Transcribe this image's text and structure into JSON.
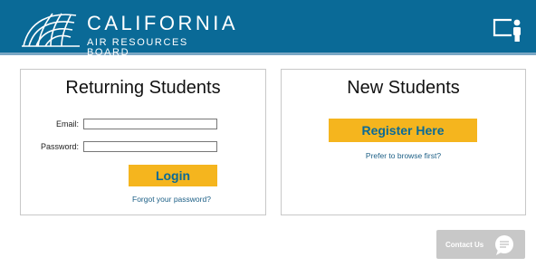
{
  "header": {
    "org_name": "CALIFORNIA",
    "org_subname": "AIR RESOURCES BOARD",
    "logo_icon": "arc-logo-icon",
    "user_icon": "user-board-icon",
    "background_color": "#0a6a97"
  },
  "returning": {
    "title": "Returning Students",
    "email_label": "Email:",
    "email_value": "",
    "password_label": "Password:",
    "password_value": "",
    "login_label": "Login",
    "forgot_label": "Forgot your password?"
  },
  "new_students": {
    "title": "New Students",
    "register_label": "Register Here",
    "browse_label": "Prefer to browse first?"
  },
  "contact": {
    "label": "Contact Us",
    "icon": "chat-bubble-icon"
  },
  "colors": {
    "accent_button": "#f5b51e",
    "button_text": "#0a6a97",
    "link": "#1c5f86"
  }
}
